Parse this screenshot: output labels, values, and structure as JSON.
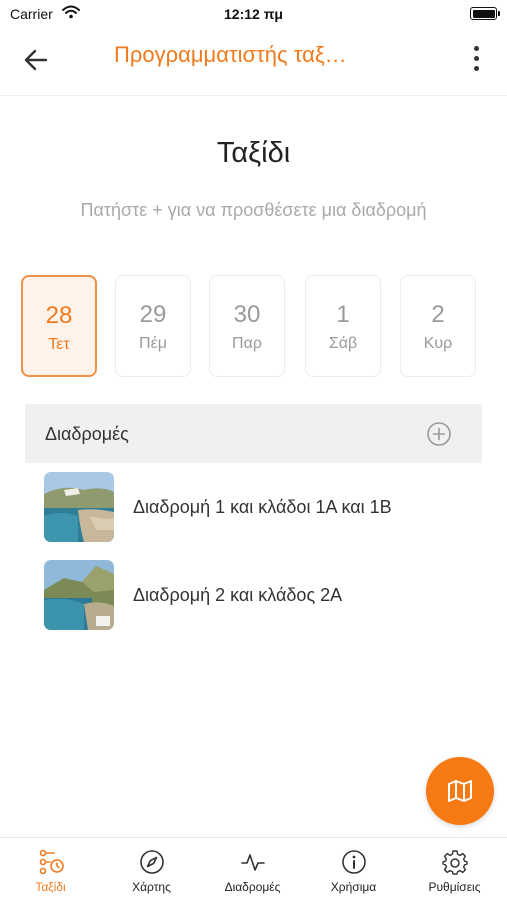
{
  "status_bar": {
    "carrier": "Carrier",
    "time": "12:12 πμ"
  },
  "header": {
    "title": "Προγραμματιστής ταξ…"
  },
  "page": {
    "title": "Ταξίδι",
    "hint": "Πατήστε + για να προσθέσετε μια διαδρομή"
  },
  "days": [
    {
      "num": "28",
      "weekday": "Τετ",
      "selected": true
    },
    {
      "num": "29",
      "weekday": "Πέμ",
      "selected": false
    },
    {
      "num": "30",
      "weekday": "Παρ",
      "selected": false
    },
    {
      "num": "1",
      "weekday": "Σάβ",
      "selected": false
    },
    {
      "num": "2",
      "weekday": "Κυρ",
      "selected": false
    }
  ],
  "routes": {
    "label": "Διαδρομές",
    "items": [
      {
        "name": "Διαδρομή 1 και κλάδοι 1Α και 1Β"
      },
      {
        "name": "Διαδρομή 2 και κλάδος 2Α"
      }
    ]
  },
  "tabs": [
    {
      "label": "Ταξίδι",
      "icon": "trip-icon",
      "active": true
    },
    {
      "label": "Χάρτης",
      "icon": "compass-icon",
      "active": false
    },
    {
      "label": "Διαδρομές",
      "icon": "activity-icon",
      "active": false
    },
    {
      "label": "Χρήσιμα",
      "icon": "info-icon",
      "active": false
    },
    {
      "label": "Ρυθμίσεις",
      "icon": "gear-icon",
      "active": false
    }
  ],
  "colors": {
    "accent": "#f07a1c",
    "fab": "#f57a14",
    "selected_bg": "#fef3ea",
    "header_bg": "#f0f0f0"
  }
}
